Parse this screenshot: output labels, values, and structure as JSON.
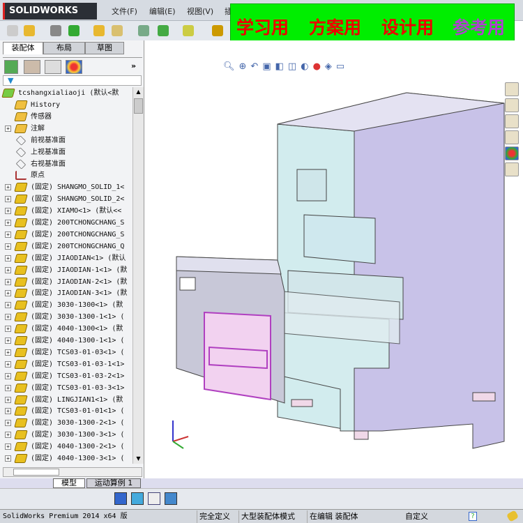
{
  "app": {
    "logo": "SOLIDWORKS",
    "menus": [
      "文件(F)",
      "编辑(E)",
      "视图(V)",
      "插"
    ]
  },
  "banner": {
    "words": [
      "学习用",
      "方案用",
      "设计用",
      "参考用"
    ],
    "colors": [
      "#e00000",
      "#e00000",
      "#e00000",
      "#b040d0"
    ]
  },
  "panel": {
    "tabs": [
      "装配体",
      "布局",
      "草图"
    ],
    "more": "»",
    "filter_icon": "filter-icon"
  },
  "tree": {
    "root": "tcshangxialiaoji  (默认<默",
    "items": [
      {
        "label": "History",
        "type": "history",
        "expand": false
      },
      {
        "label": "传感器",
        "type": "sensor",
        "expand": false
      },
      {
        "label": "注解",
        "type": "annotation",
        "expand": true
      },
      {
        "label": "前视基准面",
        "type": "plane",
        "expand": false
      },
      {
        "label": "上视基准面",
        "type": "plane",
        "expand": false
      },
      {
        "label": "右视基准面",
        "type": "plane",
        "expand": false
      },
      {
        "label": "原点",
        "type": "origin",
        "expand": false
      },
      {
        "label": "(固定) SHANGMO_SOLID_1<",
        "type": "part",
        "expand": true
      },
      {
        "label": "(固定) SHANGMO_SOLID_2<",
        "type": "part",
        "expand": true
      },
      {
        "label": "(固定) XIAMO<1> (默认<<",
        "type": "part",
        "expand": true
      },
      {
        "label": "(固定) 200TCHONGCHANG_S",
        "type": "part",
        "expand": true
      },
      {
        "label": "(固定) 200TCHONGCHANG_S",
        "type": "part",
        "expand": true
      },
      {
        "label": "(固定) 200TCHONGCHANG_Q",
        "type": "part",
        "expand": true
      },
      {
        "label": "(固定) JIAODIAN<1> (默认",
        "type": "part",
        "expand": true
      },
      {
        "label": "(固定) JIAODIAN-1<1> (默",
        "type": "part",
        "expand": true
      },
      {
        "label": "(固定) JIAODIAN-2<1> (默",
        "type": "part",
        "expand": true
      },
      {
        "label": "(固定) JIAODIAN-3<1> (默",
        "type": "part",
        "expand": true
      },
      {
        "label": "(固定) 3030-1300<1> (默",
        "type": "part",
        "expand": true
      },
      {
        "label": "(固定) 3030-1300-1<1> (",
        "type": "part",
        "expand": true
      },
      {
        "label": "(固定) 4040-1300<1> (默",
        "type": "part",
        "expand": true
      },
      {
        "label": "(固定) 4040-1300-1<1> (",
        "type": "part",
        "expand": true
      },
      {
        "label": "(固定) TCS03-01-03<1> (",
        "type": "part",
        "expand": true
      },
      {
        "label": "(固定) TCS03-01-03-1<1>",
        "type": "part",
        "expand": true
      },
      {
        "label": "(固定) TCS03-01-03-2<1>",
        "type": "part",
        "expand": true
      },
      {
        "label": "(固定) TCS03-01-03-3<1>",
        "type": "part",
        "expand": true
      },
      {
        "label": "(固定) LINGJIAN1<1> (默",
        "type": "part",
        "expand": true
      },
      {
        "label": "(固定) TCS03-01-01<1> (",
        "type": "part",
        "expand": true
      },
      {
        "label": "(固定) 3030-1300-2<1> (",
        "type": "part",
        "expand": true
      },
      {
        "label": "(固定) 3030-1300-3<1> (",
        "type": "part",
        "expand": true
      },
      {
        "label": "(固定) 4040-1300-2<1> (",
        "type": "part",
        "expand": true
      },
      {
        "label": "(固定) 4040-1300-3<1> (",
        "type": "part",
        "expand": true
      }
    ]
  },
  "bottom_tabs": [
    "模型",
    "运动算例 1"
  ],
  "status": {
    "product": "SolidWorks Premium 2014 x64 版",
    "fields": [
      "完全定义",
      "大型装配体模式",
      "在编辑 装配体",
      "自定义"
    ]
  }
}
